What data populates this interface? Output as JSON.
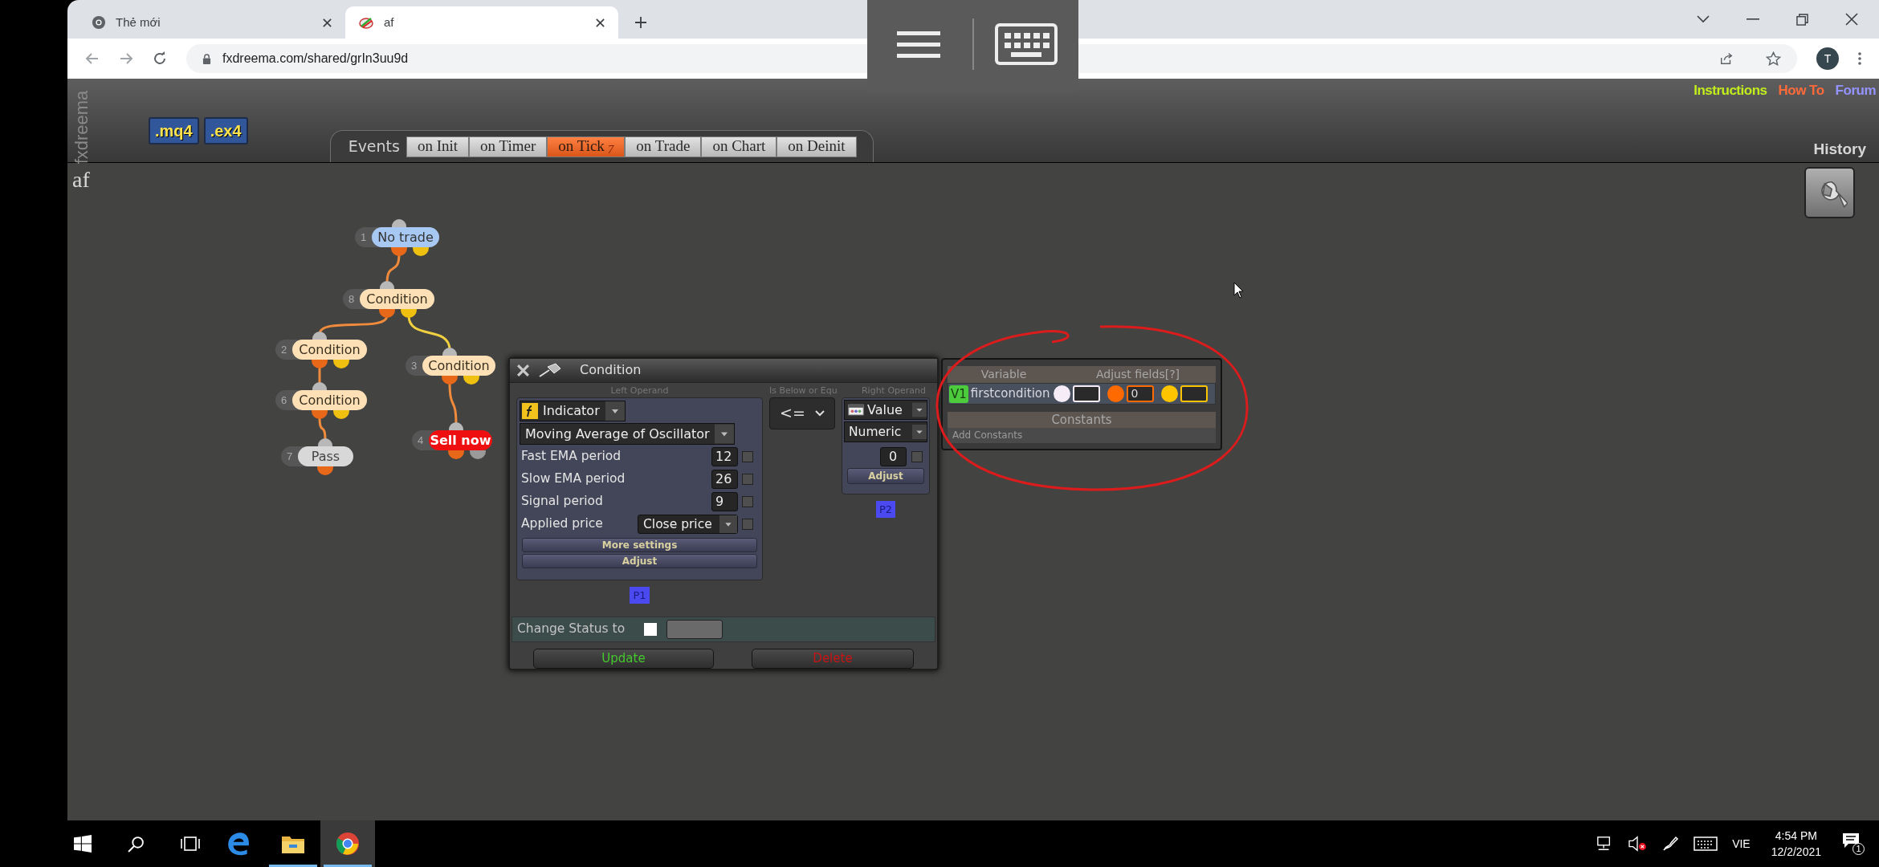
{
  "browser": {
    "tabs": [
      {
        "title": "Thẻ mới",
        "selected": false
      },
      {
        "title": "af",
        "selected": true
      }
    ],
    "url": "fxdreema.com/shared/grIn3uu9d",
    "profile_initial": "T"
  },
  "app": {
    "side_logo": "fxdreema",
    "export_buttons": [
      ".mq4",
      ".ex4"
    ],
    "events_label": "Events",
    "event_tabs": [
      {
        "label": "on Init",
        "selected": false
      },
      {
        "label": "on Timer",
        "selected": false
      },
      {
        "label": "on Tick",
        "selected": true,
        "badge": "7"
      },
      {
        "label": "on Trade",
        "selected": false
      },
      {
        "label": "on Chart",
        "selected": false
      },
      {
        "label": "on Deinit",
        "selected": false
      }
    ],
    "links": [
      {
        "label": "Instructions",
        "color": "#c2ee1c"
      },
      {
        "label": "How To",
        "color": "#ff6a3a"
      },
      {
        "label": "Forum",
        "color": "#9494ff"
      }
    ],
    "history": "History",
    "project_name": "af"
  },
  "diagram": {
    "nodes": [
      {
        "number": "1",
        "label": "No trade",
        "kind": "start"
      },
      {
        "number": "8",
        "label": "Condition",
        "kind": "condition"
      },
      {
        "number": "2",
        "label": "Condition",
        "kind": "condition"
      },
      {
        "number": "3",
        "label": "Condition",
        "kind": "condition"
      },
      {
        "number": "6",
        "label": "Condition",
        "kind": "condition"
      },
      {
        "number": "4",
        "label": "Sell now",
        "kind": "action"
      },
      {
        "number": "7",
        "label": "Pass",
        "kind": "pass"
      }
    ]
  },
  "condition_dialog": {
    "title": "Condition",
    "left_operand_label": "Left Operand",
    "operator_label": "Is Below or Equ",
    "right_operand_label": "Right Operand",
    "left": {
      "type": "Indicator",
      "indicator": "Moving Average of Oscillator",
      "params": [
        {
          "label": "Fast EMA period",
          "value": "12",
          "kind": "number",
          "checked": false
        },
        {
          "label": "Slow EMA period",
          "value": "26",
          "kind": "number",
          "checked": false
        },
        {
          "label": "Signal period",
          "value": "9",
          "kind": "number",
          "checked": false
        },
        {
          "label": "Applied price",
          "value": "Close price",
          "kind": "select",
          "checked": false
        }
      ],
      "buttons": [
        "More settings",
        "Adjust"
      ],
      "badge": "P1"
    },
    "operator": "<=",
    "right": {
      "type": "Value",
      "subtype": "Numeric",
      "value": "0",
      "checked": false,
      "button": "Adjust",
      "badge": "P2"
    },
    "status": {
      "label": "Change Status to",
      "checked": false
    },
    "actions": [
      {
        "label": "Update",
        "kind": "update"
      },
      {
        "label": "Delete",
        "kind": "delete"
      }
    ]
  },
  "variables_panel": {
    "columns": [
      "Variable",
      "Adjust fields[?]"
    ],
    "rows": [
      {
        "badge": "V1",
        "name": "firstcondition",
        "fields": [
          {
            "color": "#f6ecf8"
          },
          {
            "color": "#ff6a00",
            "value": "0"
          },
          {
            "color": "#ffc400"
          }
        ]
      }
    ],
    "constants_header": "Constants",
    "add_constants": "Add Constants"
  },
  "taskbar": {
    "apps": [
      {
        "kind": "edge",
        "running": false,
        "selected": false
      },
      {
        "kind": "explorer",
        "running": true,
        "selected": false
      },
      {
        "kind": "chrome",
        "running": true,
        "selected": true
      }
    ],
    "language": "VIE",
    "time": "4:54 PM",
    "date": "12/2/2021",
    "notification_count": "1"
  }
}
